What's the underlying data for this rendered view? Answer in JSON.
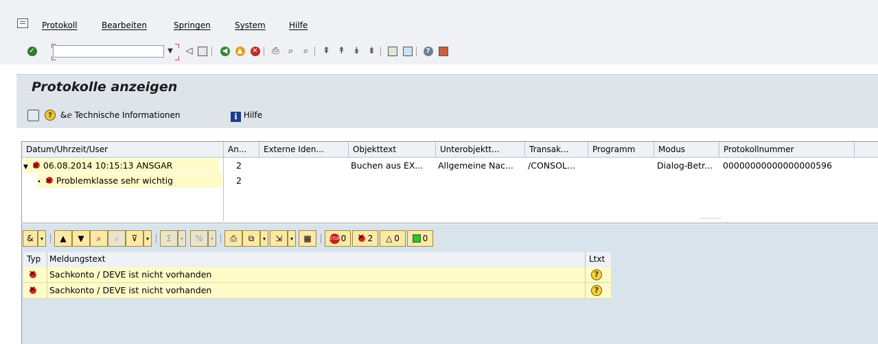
{
  "menu": {
    "items": [
      "Protokoll",
      "Bearbeiten",
      "Springen",
      "System",
      "Hilfe"
    ]
  },
  "toolbar": {
    "command_value": "",
    "icons": [
      "check-icon",
      "back-icon",
      "save-icon",
      "green-back-icon",
      "exit-icon",
      "cancel-icon",
      "print-icon",
      "find-icon",
      "find-next-icon",
      "first-page-icon",
      "prev-page-icon",
      "next-page-icon",
      "last-page-icon",
      "new-session-icon",
      "shortcut-icon",
      "help-icon",
      "customize-icon"
    ]
  },
  "title": {
    "text": "Protokolle anzeigen"
  },
  "app_toolbar": {
    "tech_info_label": "Technische Informationen",
    "help_label": "Hilfe",
    "help_glyph": "i"
  },
  "upper_table": {
    "columns": [
      "Datum/Uhrzeit/User",
      "An...",
      "Externe Iden...",
      "Objekttext",
      "Unterobjektt...",
      "Transak...",
      "Programm",
      "Modus",
      "Protokollnummer"
    ],
    "rows": [
      {
        "tree_label": "06.08.2014  10:15:13  ANSGAR",
        "anzahl": "2",
        "externe": "",
        "objekttext": "Buchen aus EX...",
        "unterobjekt": "Allgemeine Nac...",
        "transaktion": "/CONSOL...",
        "programm": "",
        "modus": "Dialog-Betr...",
        "protokollnummer": "00000000000000000596"
      },
      {
        "tree_label": "Problemklasse sehr wichtig",
        "anzahl": "2"
      }
    ]
  },
  "lower_toolbar": {
    "error_count": "2",
    "stop_count": "0",
    "warning_count": "0",
    "ok_count": "0"
  },
  "messages": {
    "columns": [
      "Typ",
      "Meldungstext",
      "Ltxt"
    ],
    "rows": [
      {
        "text": "Sachkonto / DEVE ist nicht vorhanden"
      },
      {
        "text": "Sachkonto / DEVE ist nicht vorhanden"
      }
    ]
  },
  "colors": {
    "tree_highlight": "#fffbc8",
    "title_area_bg": "#dfe4eb",
    "lower_area_bg": "#d9e3ec",
    "error_red": "#d62828"
  }
}
